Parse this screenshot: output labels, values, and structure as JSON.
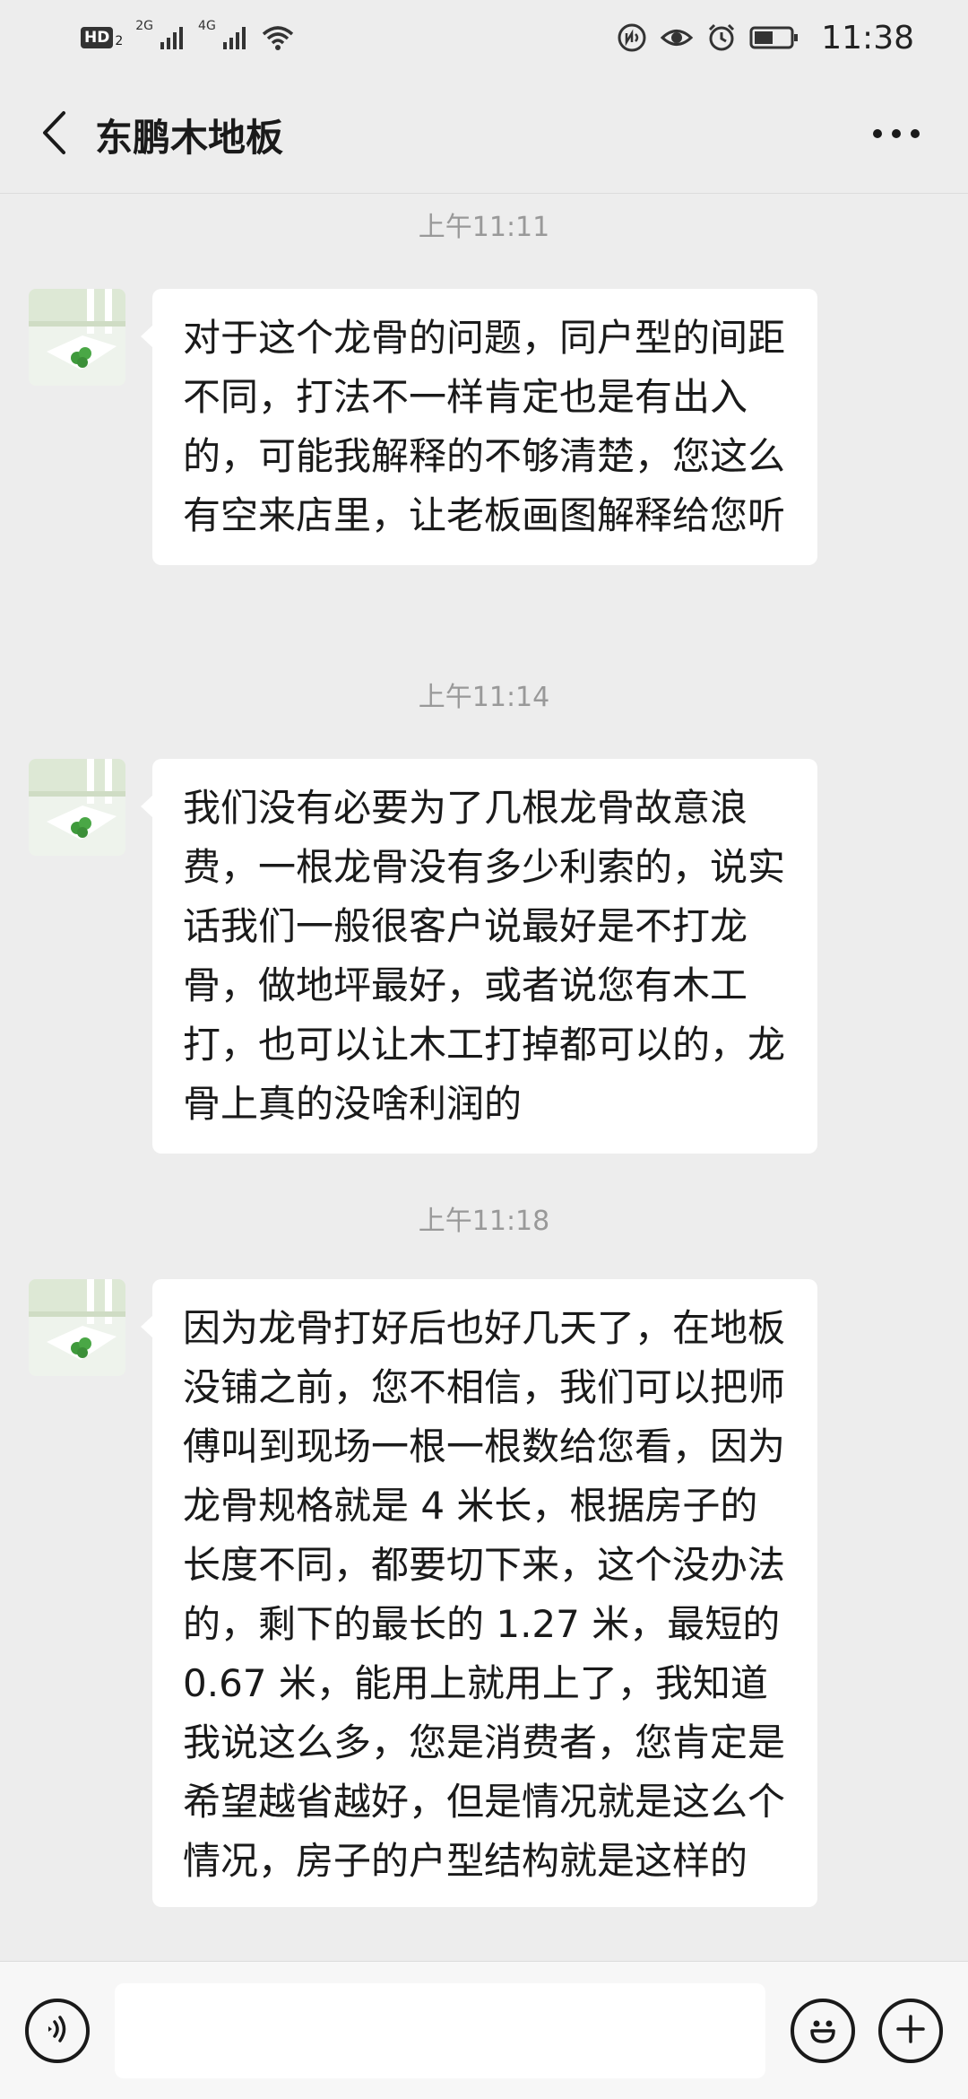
{
  "status_bar": {
    "hd_label": "HD",
    "hd_sub": "2",
    "sim1_label": "2G",
    "sim2_label": "4G",
    "time": "11:38",
    "icons": [
      "hd-icon",
      "signal-icon",
      "signal-icon",
      "wifi-icon",
      "nfc-icon",
      "eye-icon",
      "alarm-icon",
      "battery-icon"
    ]
  },
  "header": {
    "title": "东鹏木地板",
    "back_icon": "chevron-left-icon",
    "more_icon": "more-dots-icon"
  },
  "messages": [
    {
      "timestamp": "上午11:11",
      "text": "对于这个龙骨的问题，同户型的间距不同，打法不一样肯定也是有出入的，可能我解释的不够清楚，您这么有空来店里，让老板画图解释给您听"
    },
    {
      "timestamp": "上午11:14",
      "text": "我们没有必要为了几根龙骨故意浪费，一根龙骨没有多少利索的，说实话我们一般很客户说最好是不打龙骨，做地坪最好，或者说您有木工打，也可以让木工打掉都可以的，龙骨上真的没啥利润的"
    },
    {
      "timestamp": "上午11:18",
      "text": "因为龙骨打好后也好几天了，在地板没铺之前，您不相信，我们可以把师傅叫到现场一根一根数给您看，因为龙骨规格就是 4 米长，根据房子的长度不同，都要切下来，这个没办法的，剩下的最长的 1.27 米，最短的 0.67 米，能用上就用上了，我知道我说这么多，您是消费者，您肯定是希望越省越好，但是情况就是这么个情况，房子的户型结构就是这样的"
    }
  ],
  "input_bar": {
    "voice_icon": "voice-icon",
    "emoji_icon": "emoji-icon",
    "plus_icon": "plus-icon",
    "input_value": ""
  }
}
